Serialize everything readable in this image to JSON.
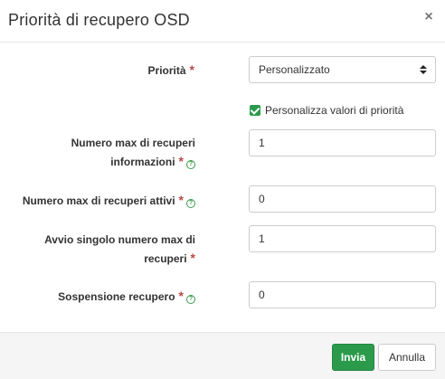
{
  "modal": {
    "title": "Priorità di recupero OSD",
    "close_glyph": "×"
  },
  "form": {
    "priority": {
      "label": "Priorità",
      "required": "*",
      "selected": "Personalizzato"
    },
    "customize": {
      "label": "Personalizza valori di priorità",
      "checked": true
    },
    "max_recovery_info": {
      "label_line1": "Numero max di recuperi",
      "label_line2": "informazioni",
      "required": "*",
      "help": "?",
      "value": "1"
    },
    "max_active_recovery": {
      "label": "Numero max di recuperi attivi",
      "required": "*",
      "help": "?",
      "value": "0"
    },
    "single_start_max_recovery": {
      "label_line1": "Avvio singolo numero max di",
      "label_line2": "recuperi",
      "required": "*",
      "value": "1"
    },
    "recovery_sleep": {
      "label": "Sospensione recupero",
      "required": "*",
      "help": "?",
      "value": "0"
    }
  },
  "footer": {
    "submit_label": "Invia",
    "cancel_label": "Annulla"
  },
  "colors": {
    "accent": "#2b9a4b",
    "required": "#b94a48"
  }
}
